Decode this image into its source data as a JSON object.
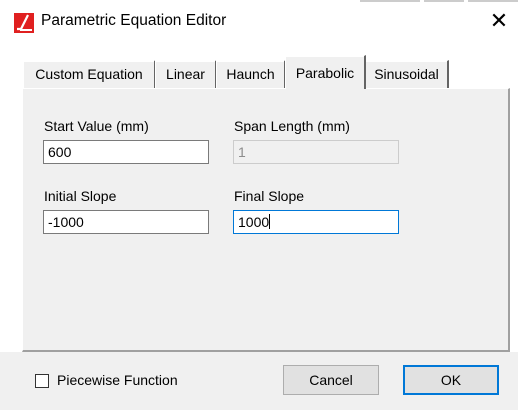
{
  "window": {
    "title": "Parametric Equation Editor",
    "close_glyph": "✕"
  },
  "tabs": [
    {
      "label": "Custom Equation"
    },
    {
      "label": "Linear"
    },
    {
      "label": "Haunch"
    },
    {
      "label": "Parabolic",
      "active": true
    },
    {
      "label": "Sinusoidal"
    }
  ],
  "form": {
    "start_value": {
      "label": "Start Value (mm)",
      "value": "600"
    },
    "span_length": {
      "label": "Span Length (mm)",
      "value": "1",
      "disabled": true
    },
    "initial_slope": {
      "label": "Initial Slope",
      "value": "-1000"
    },
    "final_slope": {
      "label": "Final Slope",
      "value": "1000",
      "focused": true
    }
  },
  "footer": {
    "piecewise_label": "Piecewise Function",
    "piecewise_checked": false,
    "cancel_label": "Cancel",
    "ok_label": "OK"
  },
  "colors": {
    "focus_border": "#0078d7",
    "icon_red": "#e02020"
  }
}
